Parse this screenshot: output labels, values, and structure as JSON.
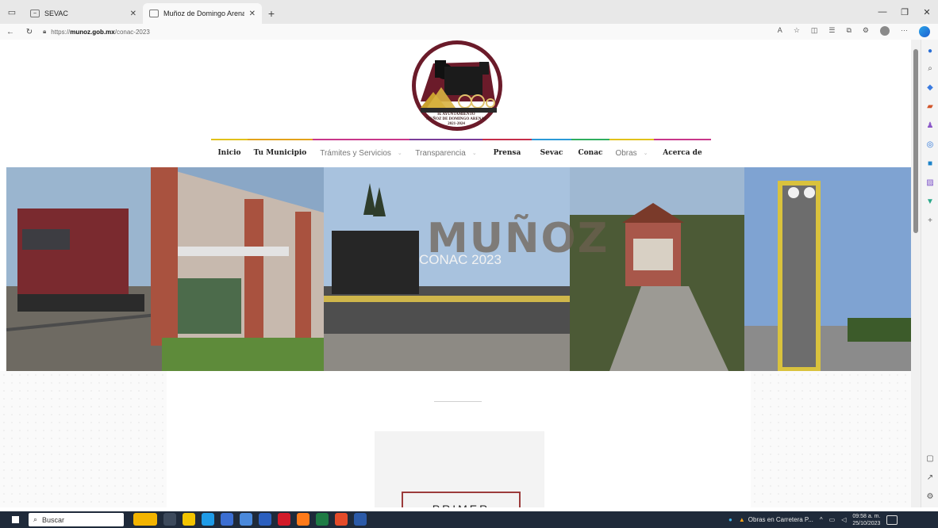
{
  "browser": {
    "tabs": [
      {
        "title": "SEVAC",
        "favicon": "sevac-icon",
        "active": false
      },
      {
        "title": "Muñoz de Domingo Arenas",
        "favicon": "page-icon",
        "active": true
      }
    ],
    "new_tab": "+",
    "url_prefix": "https://",
    "url_domain": "munoz.gob.mx",
    "url_path": "/conac-2023"
  },
  "site": {
    "logo_text": [
      "H. AYUNTAMIENTO",
      "MUÑOZ DE DOMINGO ARENAS",
      "2021-2024"
    ],
    "nav": [
      {
        "label": "Inicio",
        "style": "bold",
        "accent": "#e1c21a",
        "dropdown": false
      },
      {
        "label": "Tu Municipio",
        "style": "bold",
        "accent": "#e3a21a",
        "dropdown": false
      },
      {
        "label": "Trámites y Servicios",
        "style": "light",
        "accent": "#c8378a",
        "dropdown": true
      },
      {
        "label": "Transparencia",
        "style": "light",
        "accent": "#7a3d9a",
        "dropdown": true
      },
      {
        "label": "Prensa",
        "style": "bold",
        "accent": "#c62d4a",
        "dropdown": false
      },
      {
        "label": "Sevac",
        "style": "bold",
        "accent": "#2b9ad8",
        "dropdown": false
      },
      {
        "label": "Conac",
        "style": "bold",
        "accent": "#2fae5f",
        "dropdown": false
      },
      {
        "label": "Obras",
        "style": "light",
        "accent": "#e1c21a",
        "dropdown": true
      },
      {
        "label": "Acerca de",
        "style": "bold",
        "accent": "#c8378a",
        "dropdown": false
      }
    ],
    "hero_title": "MUÑOZ",
    "hero_subtitle": "CONAC 2023",
    "card_button": "PRIMER"
  },
  "taskbar": {
    "search_placeholder": "Buscar",
    "weather_text": "Obras en Carretera P...",
    "time": "09:58 a. m.",
    "date": "25/10/2023"
  }
}
